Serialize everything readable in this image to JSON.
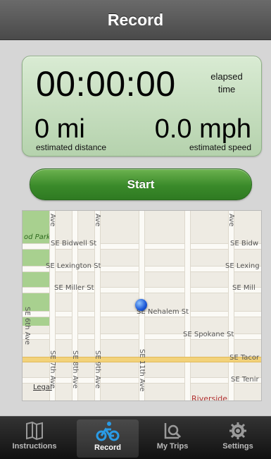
{
  "nav": {
    "title": "Record"
  },
  "stats": {
    "elapsed": "00:00:00",
    "elapsed_label": "elapsed time",
    "distance": "0 mi",
    "distance_label": "estimated distance",
    "speed": "0.0 mph",
    "speed_label": "estimated speed"
  },
  "start_button": {
    "label": "Start"
  },
  "map": {
    "park_label": "od Park",
    "streets_h": [
      "SE Bidwell St",
      "SE Lexington St",
      "SE Miller St",
      "SE Nehalem St",
      "SE Spokane St"
    ],
    "streets_h_right": [
      "SE Bidw",
      "SE Lexing",
      "SE Mill",
      "SE Tacor",
      "SE Tenir"
    ],
    "streets_v": [
      "SE 6th Ave",
      "SE 7th Ave",
      "SE 8th Ave",
      "SE 9th Ave",
      "SE 11th Ave"
    ],
    "ave_stub_1": "Ave",
    "ave_stub_2": "Ave",
    "ave_stub_3": "Ave",
    "legal": "Legal",
    "area_label": "Riverside"
  },
  "tabs": [
    {
      "label": "Instructions",
      "icon": "map-book-icon"
    },
    {
      "label": "Record",
      "icon": "bicycle-icon"
    },
    {
      "label": "My Trips",
      "icon": "trips-search-icon"
    },
    {
      "label": "Settings",
      "icon": "gear-icon"
    }
  ],
  "colors": {
    "panel": "#c9e2c1",
    "start_button": "#3f8f2d",
    "tab_active_icon": "#2a9be6",
    "pin": "#1a56d6"
  }
}
